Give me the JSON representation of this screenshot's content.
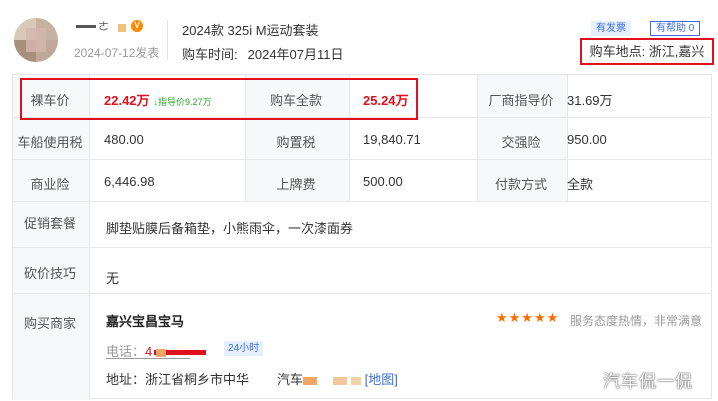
{
  "header": {
    "user_name": "",
    "post_date": "2024-07-12发表",
    "car_model": "2024款 325i M运动套装",
    "buy_time_label": "购车时间:",
    "buy_time_value": "2024年07月11日",
    "tag_invoice": "有发票",
    "tag_helpful": "有帮助 0",
    "location": "购车地点: 浙江,嘉兴"
  },
  "table": {
    "bare_price_label": "裸车价",
    "bare_price_value": "22.42万",
    "guide_price_note": "↓指导价9.27万",
    "full_price_label": "购车全款",
    "full_price_value": "25.24万",
    "msrp_label": "厂商指导价",
    "msrp_value": "31.69万",
    "vehicle_tax_label": "车船使用税",
    "vehicle_tax_value": "480.00",
    "purchase_tax_label": "购置税",
    "purchase_tax_value": "19,840.71",
    "compulsory_ins_label": "交强险",
    "compulsory_ins_value": "950.00",
    "commercial_ins_label": "商业险",
    "commercial_ins_value": "6,446.98",
    "plate_fee_label": "上牌费",
    "plate_fee_value": "500.00",
    "payment_label": "付款方式",
    "payment_value": "全款",
    "promo_label": "促销套餐",
    "promo_value": "脚垫贴膜后备箱垫，小熊雨伞，一次漆面券",
    "bargain_label": "砍价技巧",
    "bargain_value": "无",
    "dealer_label": "购买商家"
  },
  "dealer": {
    "name": "嘉兴宝昌宝马",
    "stars": "★★★★★",
    "service": "服务态度热情，非常满意",
    "phone_label": "电话：",
    "phone_prefix": "4",
    "hours_tag": "24小时",
    "address_label": "地址：",
    "address_value": "浙江省桐乡市中华",
    "address_mid": "汽车",
    "map_link": "[地图]"
  },
  "watermark": "汽车侃一侃",
  "colors": {
    "accent_red": "#e0101d",
    "link_blue": "#3a6fd6",
    "star_orange": "#ff6a00",
    "guide_green": "#2aa52a"
  }
}
